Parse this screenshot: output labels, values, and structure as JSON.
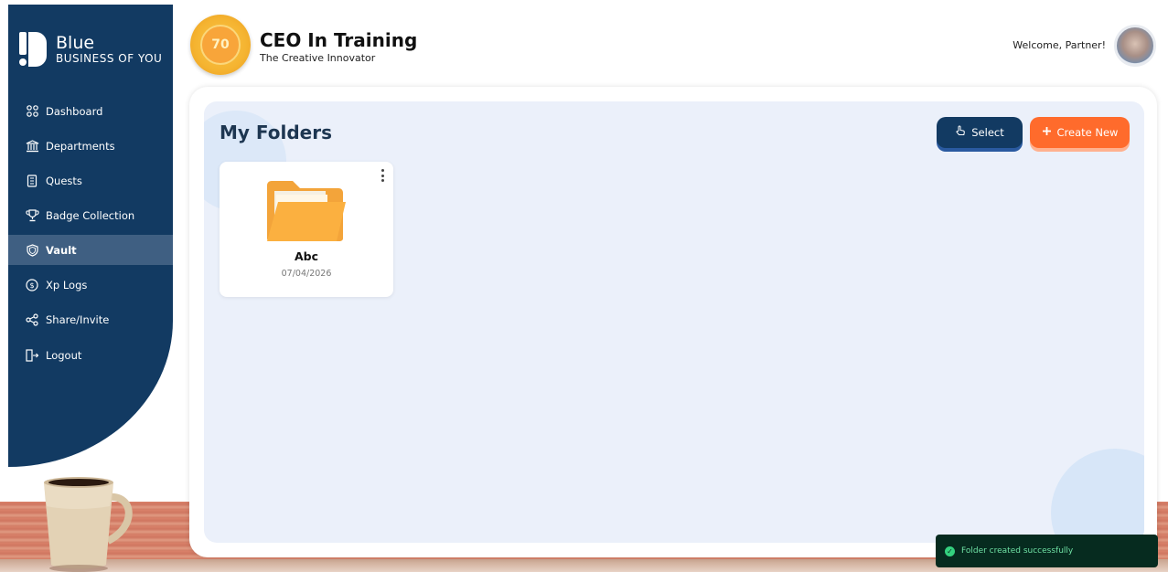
{
  "brand": {
    "name": "Blue",
    "tagline": "BUSINESS OF YOU"
  },
  "sidebar": {
    "items": [
      {
        "label": "Dashboard",
        "icon": "grid-icon"
      },
      {
        "label": "Departments",
        "icon": "bank-icon"
      },
      {
        "label": "Quests",
        "icon": "scroll-icon"
      },
      {
        "label": "Badge Collection",
        "icon": "trophy-icon"
      },
      {
        "label": "Vault",
        "icon": "shield-icon",
        "active": true
      },
      {
        "label": "Xp Logs",
        "icon": "dollar-circle-icon"
      },
      {
        "label": "Share/Invite",
        "icon": "share-icon"
      },
      {
        "label": "Logout",
        "icon": "logout-icon"
      }
    ]
  },
  "header": {
    "level": "70",
    "title": "CEO In Training",
    "subtitle": "The Creative Innovator",
    "welcome": "Welcome, Partner!"
  },
  "main": {
    "title": "My Folders",
    "select_label": "Select",
    "create_label": "Create New",
    "folders": [
      {
        "name": "Abc",
        "date": "07/04/2026"
      }
    ]
  },
  "toast": {
    "message": "Folder created successfully"
  },
  "colors": {
    "sidebar": "#123a62",
    "accent": "#ff6b2c",
    "content_bg": "#ebf0fa"
  }
}
